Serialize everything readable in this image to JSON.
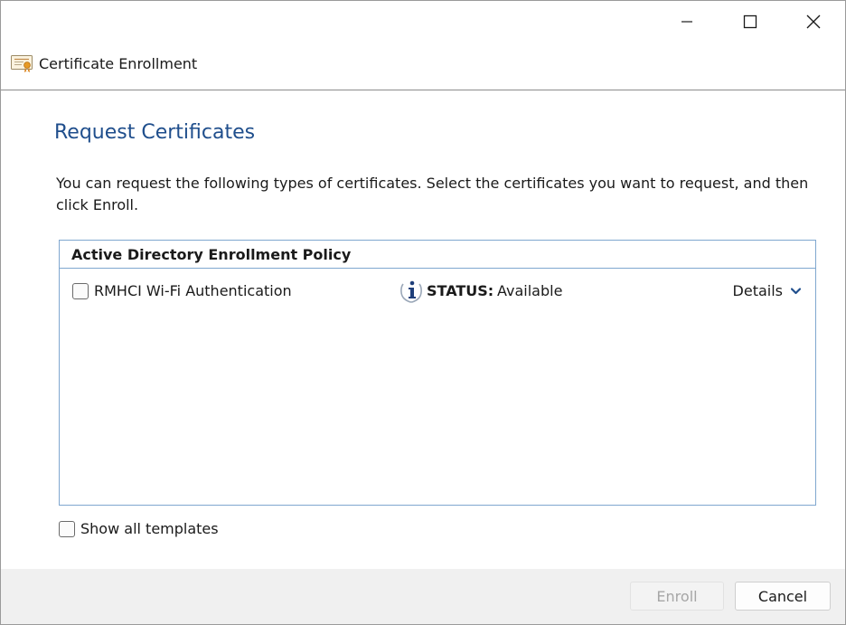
{
  "window": {
    "title": "Certificate Enrollment",
    "app_icon": "certificate-icon",
    "controls": [
      "minimize-icon",
      "maximize-icon",
      "close-icon"
    ]
  },
  "page": {
    "heading": "Request Certificates",
    "instructions": "You can request the following types of certificates. Select the certificates you want to request, and then click Enroll."
  },
  "policy_group": {
    "header": "Active Directory Enrollment Policy",
    "items": [
      {
        "name": "RMHCI Wi-Fi Authentication",
        "checked": false,
        "status_icon": "info-icon",
        "status_label": "STATUS:",
        "status_value": "Available",
        "details_label": "Details",
        "details_icon": "chevron-down-icon"
      }
    ]
  },
  "options": {
    "show_all_templates": "Show all templates",
    "show_all_checked": false
  },
  "buttons": {
    "enroll": "Enroll",
    "enroll_enabled": false,
    "cancel": "Cancel"
  },
  "colors": {
    "heading": "#1f4e8c",
    "list_border": "#7fa7cf",
    "chevron": "#1f4e8c",
    "footer_bg": "#f0f0f0"
  }
}
